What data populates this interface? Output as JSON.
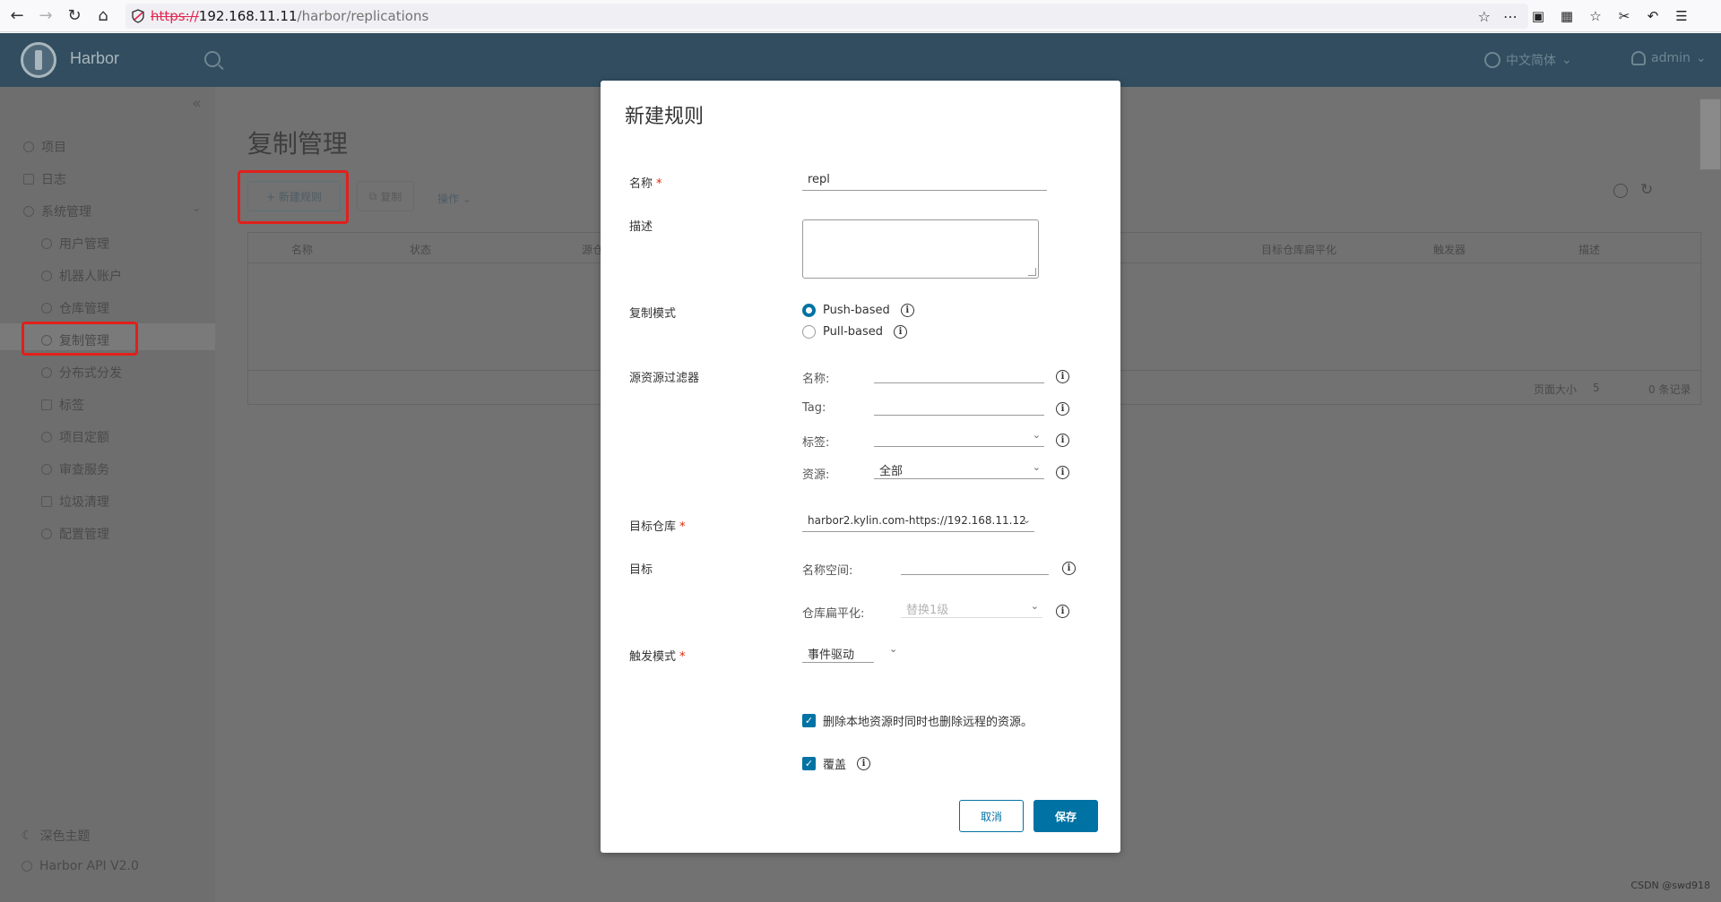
{
  "browser": {
    "url_scheme": "https://",
    "url_host": "192.168.11.11",
    "url_path": "/harbor/replications"
  },
  "header": {
    "brand": "Harbor",
    "language": "中文简体",
    "user": "admin"
  },
  "sidebar": {
    "items": [
      {
        "label": "项目"
      },
      {
        "label": "日志"
      },
      {
        "label": "系统管理"
      }
    ],
    "sub_items": [
      {
        "label": "用户管理"
      },
      {
        "label": "机器人账户"
      },
      {
        "label": "仓库管理"
      },
      {
        "label": "复制管理"
      },
      {
        "label": "分布式分发"
      },
      {
        "label": "标签"
      },
      {
        "label": "项目定额"
      },
      {
        "label": "审查服务"
      },
      {
        "label": "垃圾清理"
      },
      {
        "label": "配置管理"
      }
    ],
    "bottom": [
      {
        "label": "深色主题"
      },
      {
        "label": "Harbor API V2.0"
      }
    ]
  },
  "main": {
    "title": "复制管理",
    "new_rule_button": "+ 新建规则",
    "copy_button": "复制",
    "operations": "操作",
    "columns": [
      "名称",
      "状态",
      "源仓",
      "目标仓库扁平化",
      "触发器",
      "描述"
    ],
    "page_size_label": "页面大小",
    "page_size_value": "5",
    "record_count": "0 条记录"
  },
  "modal": {
    "title": "新建规则",
    "name_label": "名称",
    "name_value": "repl",
    "description_label": "描述",
    "replication_mode_label": "复制模式",
    "mode_push": "Push-based",
    "mode_pull": "Pull-based",
    "source_filter_label": "源资源过滤器",
    "filter_name_label": "名称:",
    "filter_tag_label": "Tag:",
    "filter_label_label": "标签:",
    "filter_resource_label": "资源:",
    "filter_resource_value": "全部",
    "dest_registry_label": "目标仓库",
    "dest_registry_value": "harbor2.kylin.com-https://192.168.11.12",
    "target_label": "目标",
    "namespace_label": "名称空间:",
    "flatten_label": "仓库扁平化:",
    "flatten_value": "替换1级",
    "trigger_label": "触发模式",
    "trigger_value": "事件驱动",
    "delete_remote_label": "删除本地资源时同时也删除远程的资源。",
    "override_label": "覆盖",
    "cancel_button": "取消",
    "save_button": "保存"
  },
  "watermark": "CSDN @swd918",
  "colors": {
    "primary": "#0072a3",
    "header": "#314d5f",
    "required": "#e12200",
    "highlight_frame": "#e0201b"
  }
}
